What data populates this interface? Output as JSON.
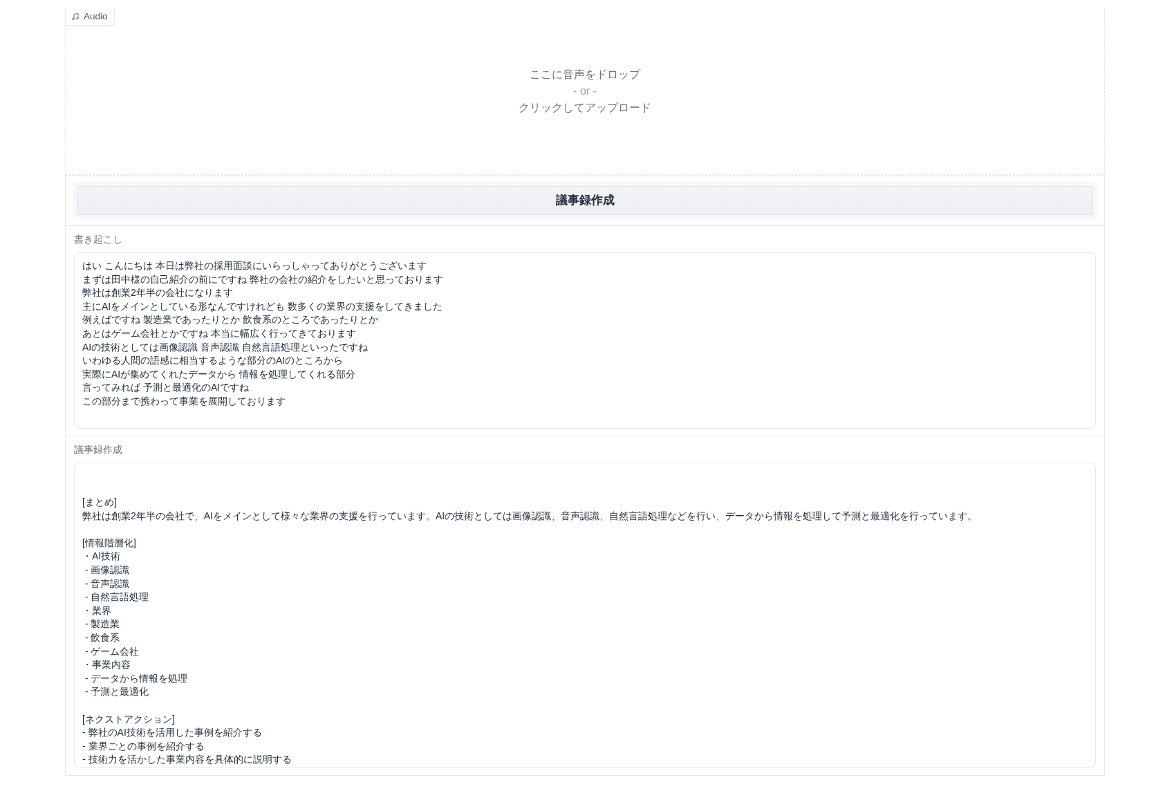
{
  "audio_input": {
    "label": "Audio",
    "drop_text": "ここに音声をドロップ",
    "or_text": "- or -",
    "upload_text": "クリックしてアップロード"
  },
  "generate_button": {
    "label": "議事録作成"
  },
  "outputs": [
    {
      "label": "書き起こし",
      "blocks": [
        [
          "はい こんにちは 本日は弊社の採用面談にいらっしゃってありがとうございます",
          "まずは田中様の自己紹介の前にですね 弊社の会社の紹介をしたいと思っております",
          "弊社は創業2年半の会社になります",
          "主にAIをメインとしている形なんですけれども 数多くの業界の支援をしてきました",
          "例えばですね 製造業であったりとか 飲食系のところであったりとか",
          "あとはゲーム会社とかですね 本当に幅広く行ってきております",
          "AIの技術としては画像認識 音声認識 自然言語処理といったですね",
          "いわゆる人間の語感に相当するような部分のAIのところから",
          "実際にAIが集めてくれたデータから 情報を処理してくれる部分",
          "言ってみれば 予測と最適化のAIですね",
          "この部分まで携わって事業を展開しております"
        ]
      ]
    },
    {
      "label": "議事録作成",
      "blocks": [
        [
          "[まとめ]",
          "弊社は創業2年半の会社で、AIをメインとして様々な業界の支援を行っています。AIの技術としては画像認識、音声認識、自然言語処理などを行い、データから情報を処理して予測と最適化を行っています。"
        ],
        [
          "[情報階層化]",
          "・AI技術",
          " - 画像認識",
          " - 音声認識",
          " - 自然言語処理",
          "・業界",
          " - 製造業",
          " - 飲食系",
          " - ゲーム会社",
          "・事業内容",
          " - データから情報を処理",
          " - 予測と最適化"
        ],
        [
          "[ネクストアクション]",
          "- 弊社のAI技術を活用した事例を紹介する",
          "- 業界ごとの事例を紹介する",
          "- 技術力を活かした事業内容を具体的に説明する"
        ]
      ]
    }
  ]
}
